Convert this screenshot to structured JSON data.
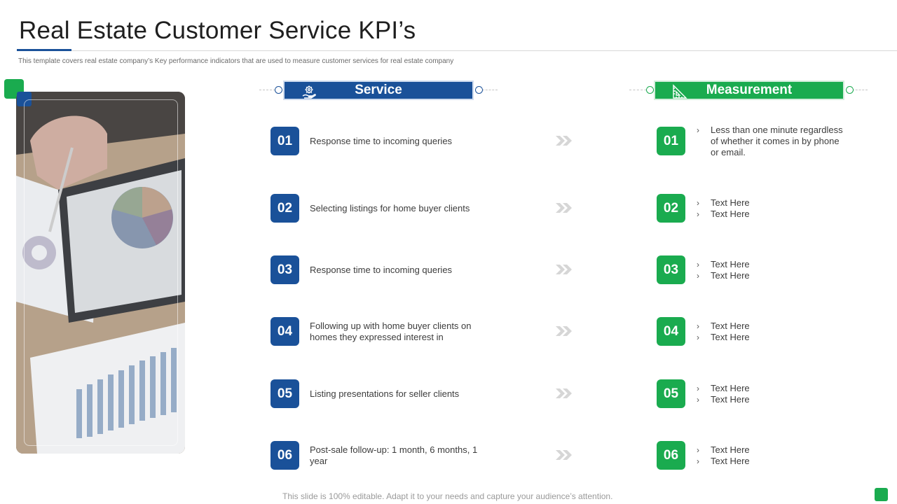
{
  "title": "Real Estate Customer Service KPI’s",
  "subtitle": "This template covers real estate company’s Key performance indicators that are used to measure customer services for real estate company",
  "colors": {
    "blue": "#1a5199",
    "green": "#1aab4f"
  },
  "headers": {
    "service": {
      "label": "Service",
      "icon": "gear-hand-icon"
    },
    "measurement": {
      "label": "Measurement",
      "icon": "ruler-triangle-icon"
    }
  },
  "rows": [
    {
      "num": "01",
      "service": "Response time to incoming queries",
      "measure": [
        "Less than one minute regardless of whether it comes in by phone or email."
      ]
    },
    {
      "num": "02",
      "service": "Selecting listings for home buyer clients",
      "measure": [
        "Text Here",
        "Text Here"
      ]
    },
    {
      "num": "03",
      "service": "Response time to incoming queries",
      "measure": [
        "Text Here",
        "Text Here"
      ]
    },
    {
      "num": "04",
      "service": "Following up with home buyer clients on homes they expressed interest in",
      "measure": [
        "Text Here",
        "Text Here"
      ]
    },
    {
      "num": "05",
      "service": "Listing presentations for seller clients",
      "measure": [
        "Text Here",
        "Text Here"
      ]
    },
    {
      "num": "06",
      "service": "Post-sale follow-up: 1 month, 6 months, 1 year",
      "measure": [
        "Text Here",
        "Text Here"
      ]
    }
  ],
  "bullet_glyph": "›",
  "footer": "This slide is 100% editable. Adapt it to your needs and capture your audience’s attention."
}
